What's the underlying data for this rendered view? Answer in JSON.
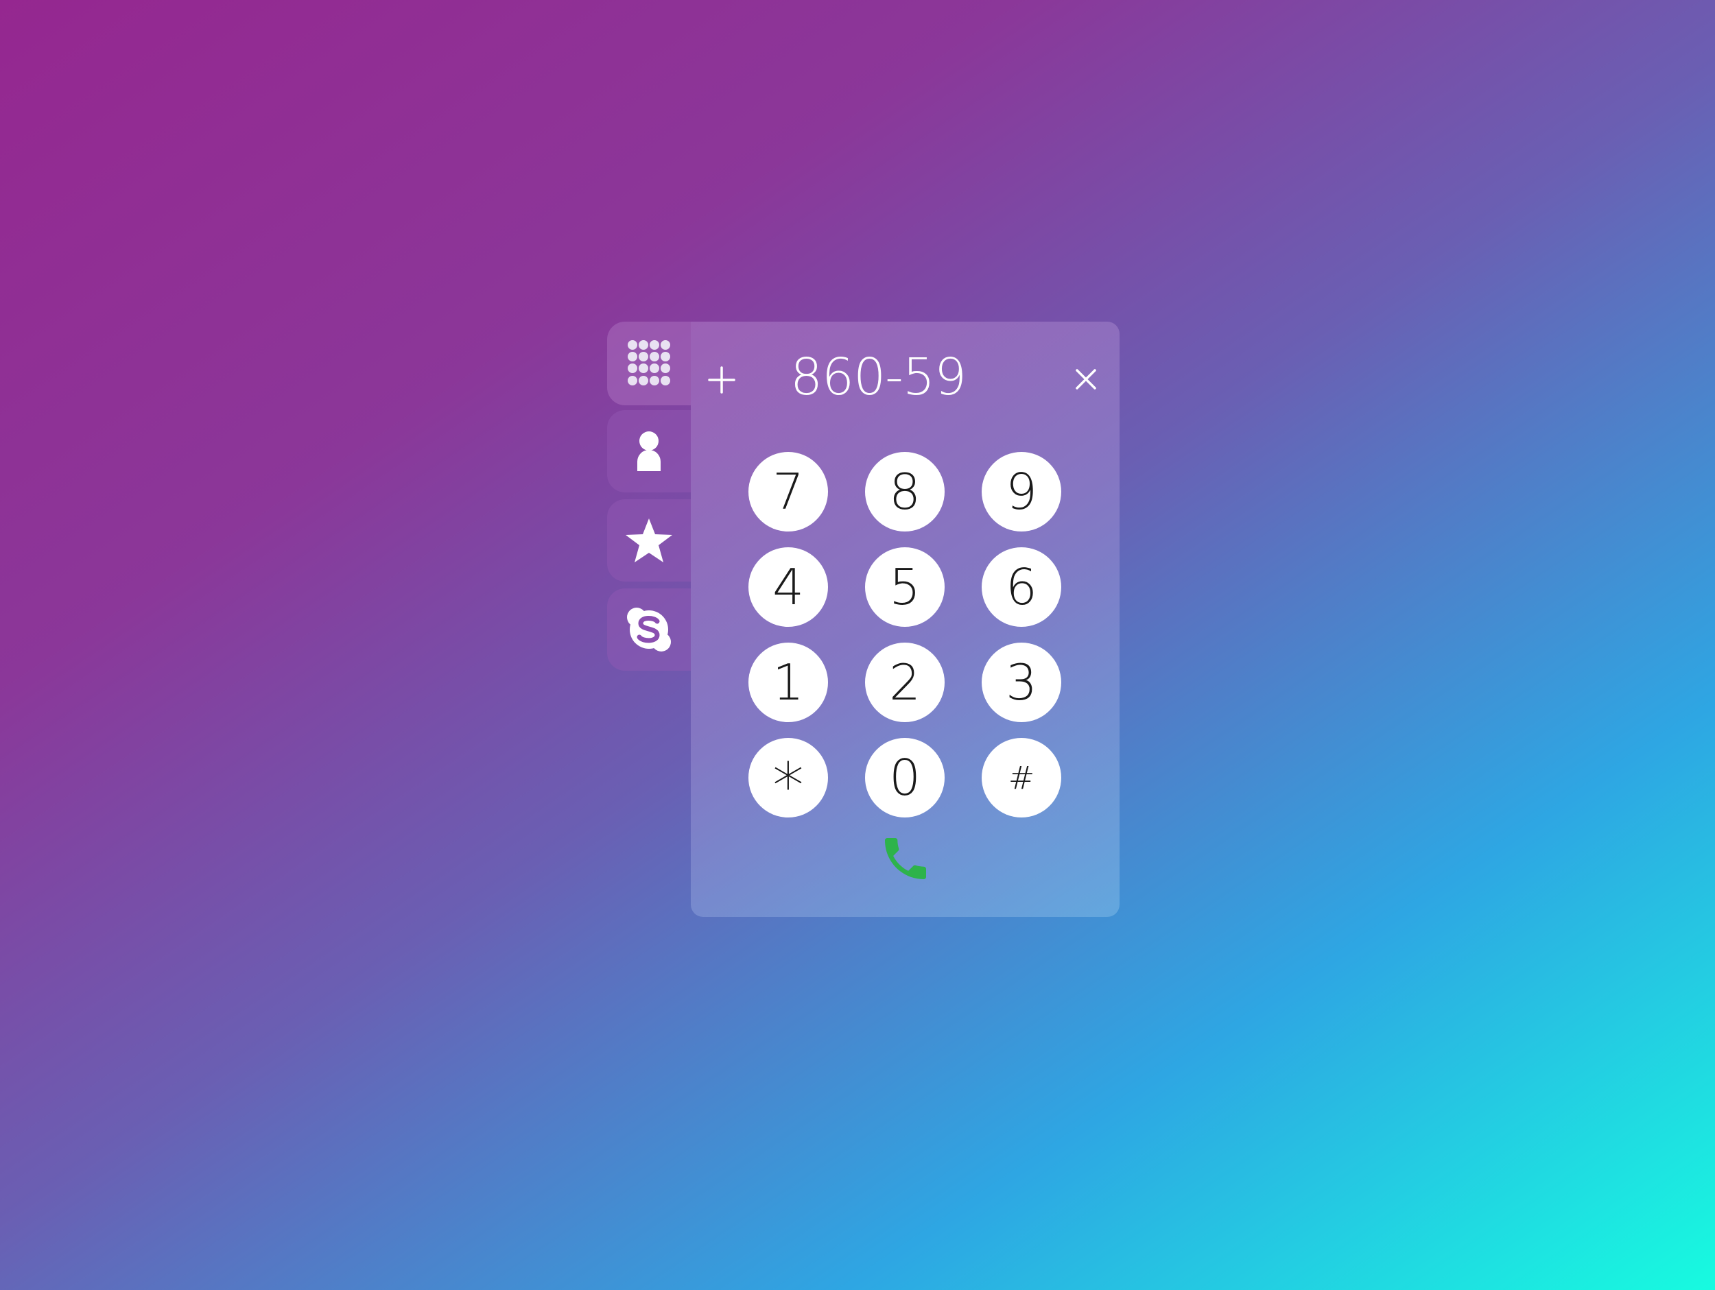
{
  "dialer": {
    "number": "860-59",
    "plus_label": "+",
    "close_label": "×",
    "keys": {
      "k7": "7",
      "k8": "8",
      "k9": "9",
      "k4": "4",
      "k5": "5",
      "k6": "6",
      "k1": "1",
      "k2": "2",
      "k3": "3",
      "kstar": "*",
      "k0": "0",
      "khash": "#"
    }
  },
  "tabs": [
    {
      "icon": "dialpad-icon",
      "active": true
    },
    {
      "icon": "contact-icon",
      "active": false
    },
    {
      "icon": "star-icon",
      "active": false
    },
    {
      "icon": "skype-icon",
      "active": false
    }
  ],
  "colors": {
    "call": "#2db34a",
    "key_background": "#ffffff",
    "text_light": "#ffffff"
  }
}
